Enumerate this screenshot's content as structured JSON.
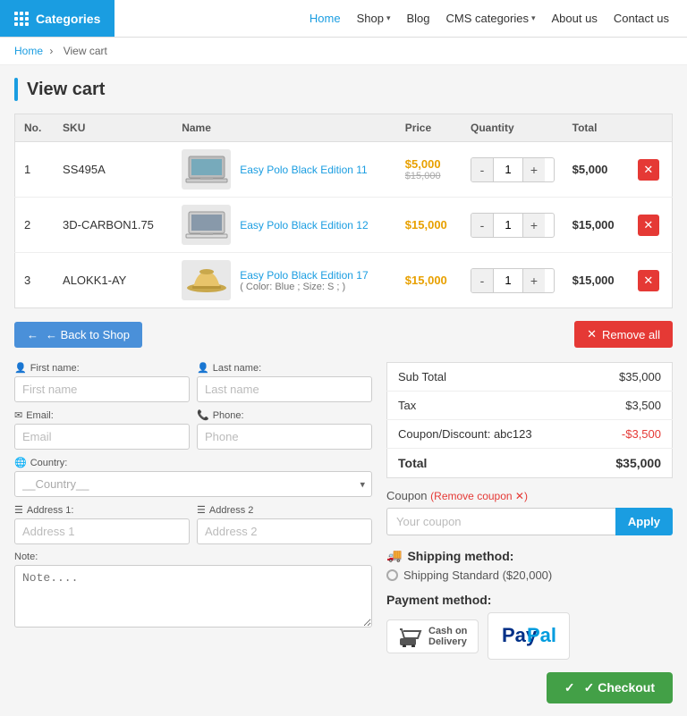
{
  "header": {
    "categories_label": "Categories",
    "nav": [
      {
        "label": "Home",
        "active": true
      },
      {
        "label": "Shop",
        "dropdown": true
      },
      {
        "label": "Blog"
      },
      {
        "label": "CMS categories",
        "dropdown": true
      },
      {
        "label": "About us"
      },
      {
        "label": "Contact us"
      }
    ]
  },
  "breadcrumb": {
    "home": "Home",
    "current": "View cart"
  },
  "page": {
    "title": "View cart"
  },
  "table": {
    "headers": [
      "No.",
      "SKU",
      "Name",
      "Price",
      "Quantity",
      "Total"
    ],
    "rows": [
      {
        "no": "1",
        "sku": "SS495A",
        "name": "Easy Polo Black Edition 11",
        "price_sale": "$5,000",
        "price_original": "$15,000",
        "qty": "1",
        "total": "$5,000"
      },
      {
        "no": "2",
        "sku": "3D-CARBON1.75",
        "name": "Easy Polo Black Edition 12",
        "price_sale": "$15,000",
        "price_original": "",
        "qty": "1",
        "total": "$15,000"
      },
      {
        "no": "3",
        "sku": "ALOKK1-AY",
        "name": "Easy Polo Black Edition 17",
        "name_sub": "( Color: Blue ; Size: S ; )",
        "price_sale": "$15,000",
        "price_original": "",
        "qty": "1",
        "total": "$15,000"
      }
    ]
  },
  "actions": {
    "back_to_shop": "← Back to Shop",
    "remove_all": "Remove all"
  },
  "form": {
    "first_name_label": "First name:",
    "last_name_label": "Last name:",
    "first_name_placeholder": "First name",
    "last_name_placeholder": "Last name",
    "email_label": "Email:",
    "phone_label": "Phone:",
    "email_placeholder": "Email",
    "phone_placeholder": "Phone",
    "country_label": "Country:",
    "country_placeholder": "__Country__",
    "address1_label": "Address 1:",
    "address2_label": "Address 2",
    "address1_placeholder": "Address 1",
    "address2_placeholder": "Address 2",
    "note_label": "Note:",
    "note_placeholder": "Note...."
  },
  "summary": {
    "rows": [
      {
        "label": "Sub Total",
        "amount": "$35,000",
        "negative": false
      },
      {
        "label": "Tax",
        "amount": "$3,500",
        "negative": false
      },
      {
        "label": "Coupon/Discount: abc123",
        "amount": "-$3,500",
        "negative": true
      },
      {
        "label": "Total",
        "amount": "$35,000",
        "negative": false
      }
    ]
  },
  "coupon": {
    "label": "Coupon",
    "remove_text": "Remove coupon ✕",
    "placeholder": "Your coupon",
    "apply_label": "Apply"
  },
  "shipping": {
    "title": "Shipping method:",
    "option": "Shipping Standard ($20,000)"
  },
  "payment": {
    "title": "Payment method:",
    "options": [
      {
        "label": "Cash on Delivery",
        "type": "cash"
      },
      {
        "label": "PayPal",
        "type": "paypal"
      }
    ]
  },
  "checkout": {
    "label": "✓ Checkout"
  }
}
